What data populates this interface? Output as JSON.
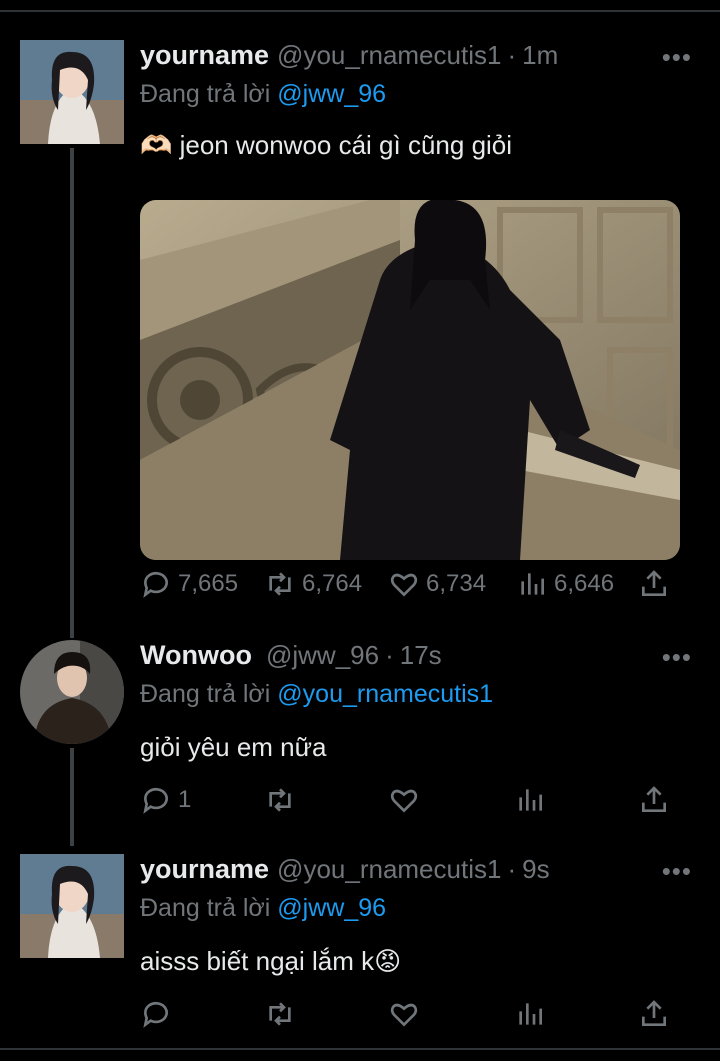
{
  "tweets": [
    {
      "name": "yourname",
      "handle": "@you_rnamecutis1",
      "time": "1m",
      "reply_prefix": "Đang trả lời",
      "reply_to": "@jww_96",
      "text": "🫶🏻 jeon wonwoo cái gì cũng giỏi",
      "stats": {
        "replies": "7,665",
        "retweets": "6,764",
        "likes": "6,734",
        "views": "6,646"
      }
    },
    {
      "name": "Wonwoo",
      "handle": "@jww_96",
      "time": "17s",
      "reply_prefix": "Đang trả lời",
      "reply_to": "@you_rnamecutis1",
      "text": "giỏi yêu em nữa",
      "stats": {
        "replies": "1"
      }
    },
    {
      "name": "yourname",
      "handle": "@you_rnamecutis1",
      "time": "9s",
      "reply_prefix": "Đang trả lời",
      "reply_to": "@jww_96",
      "text": "aisss biết ngại lắm k😡"
    }
  ],
  "ui": {
    "separator": "·",
    "more_glyph": "•••"
  },
  "icons": [
    "reply-icon",
    "retweet-icon",
    "like-icon",
    "views-icon",
    "share-icon",
    "more-icon"
  ]
}
